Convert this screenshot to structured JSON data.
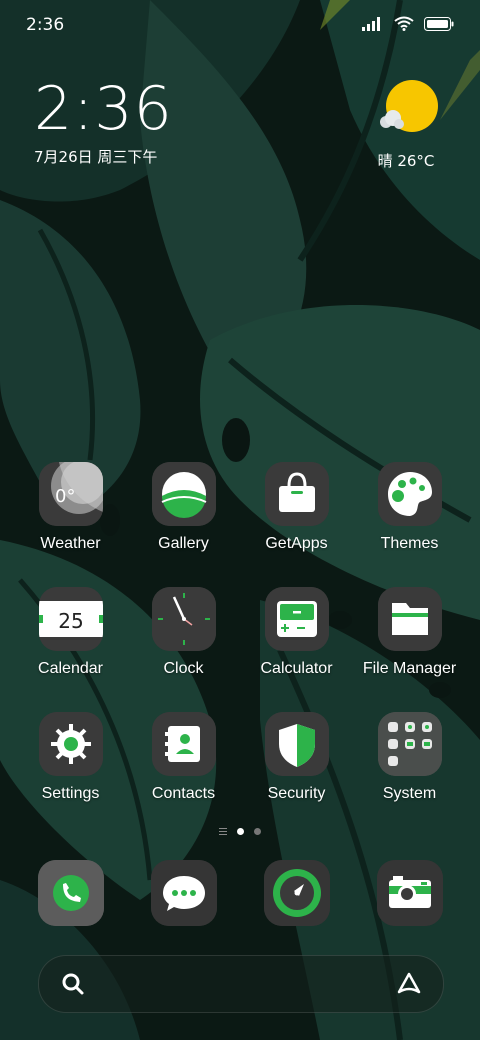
{
  "status_bar": {
    "time": "2:36"
  },
  "clock_widget": {
    "time": "2:36",
    "date": "7月26日 周三下午"
  },
  "weather_widget": {
    "text": "晴 26°C"
  },
  "apps": [
    {
      "label": "Weather",
      "icon": "weather-icon",
      "badge_text": "0°"
    },
    {
      "label": "Gallery",
      "icon": "gallery-icon"
    },
    {
      "label": "GetApps",
      "icon": "shopping-bag-icon"
    },
    {
      "label": "Themes",
      "icon": "palette-icon"
    },
    {
      "label": "Calendar",
      "icon": "calendar-icon",
      "badge_text": "25"
    },
    {
      "label": "Clock",
      "icon": "clock-icon"
    },
    {
      "label": "Calculator",
      "icon": "calculator-icon"
    },
    {
      "label": "File Manager",
      "icon": "folder-icon"
    },
    {
      "label": "Settings",
      "icon": "gear-icon"
    },
    {
      "label": "Contacts",
      "icon": "contacts-icon"
    },
    {
      "label": "Security",
      "icon": "shield-icon"
    },
    {
      "label": "System",
      "icon": "folder-grid-icon"
    }
  ],
  "page_indicator": {
    "pages": 2,
    "active": 1
  },
  "dock": [
    {
      "icon": "phone-icon"
    },
    {
      "icon": "messages-icon"
    },
    {
      "icon": "browser-compass-icon"
    },
    {
      "icon": "camera-icon"
    }
  ],
  "colors": {
    "accent_green": "#2db34a",
    "icon_bg": "#3a3a3a",
    "sun_yellow": "#f7c600"
  }
}
